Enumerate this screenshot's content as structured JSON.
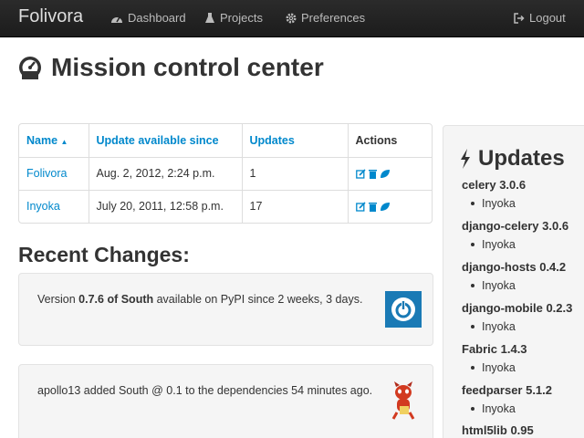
{
  "navbar": {
    "brand": "Folivora",
    "items": [
      {
        "label": "Dashboard",
        "icon": "dashboard-icon"
      },
      {
        "label": "Projects",
        "icon": "flask-icon"
      },
      {
        "label": "Preferences",
        "icon": "gear-icon"
      }
    ],
    "logout": {
      "label": "Logout",
      "icon": "logout-icon"
    }
  },
  "page": {
    "title": "Mission control center",
    "icon": "dashboard-icon"
  },
  "projects_table": {
    "headers": [
      "Name",
      "Update available since",
      "Updates",
      "Actions"
    ],
    "sort_indicator": "up-arrow",
    "rows": [
      {
        "name": "Folivora",
        "since": "Aug. 2, 2012, 2:24 p.m.",
        "updates": "1"
      },
      {
        "name": "Inyoka",
        "since": "July 20, 2011, 12:58 p.m.",
        "updates": "17"
      }
    ],
    "action_icons": [
      "edit-icon",
      "trash-icon",
      "leaf-icon"
    ]
  },
  "recent_changes": {
    "title": "Recent Changes:",
    "items": [
      {
        "prefix": "Version ",
        "bold": "0.7.6 of South",
        "suffix": " available on PyPI since 2 weeks, 3 days.",
        "avatar": "power-logo"
      },
      {
        "prefix": "apollo13 added South @ 0.1 to the dependencies 54 minutes ago.",
        "bold": "",
        "suffix": "",
        "avatar": "devil-avatar"
      }
    ]
  },
  "updates": {
    "title": "Updates",
    "icon": "bolt-icon",
    "items": [
      {
        "name": "celery 3.0.6",
        "project": "Inyoka"
      },
      {
        "name": "django-celery 3.0.6",
        "project": "Inyoka"
      },
      {
        "name": "django-hosts 0.4.2",
        "project": "Inyoka"
      },
      {
        "name": "django-mobile 0.2.3",
        "project": "Inyoka"
      },
      {
        "name": "Fabric 1.4.3",
        "project": "Inyoka"
      },
      {
        "name": "feedparser 5.1.2",
        "project": "Inyoka"
      },
      {
        "name": "html5lib 0.95",
        "project": ""
      }
    ]
  },
  "colors": {
    "link": "#0088cc",
    "navbar": "#222222",
    "well": "#f5f5f5",
    "accent_green": "#2a9a4a"
  }
}
